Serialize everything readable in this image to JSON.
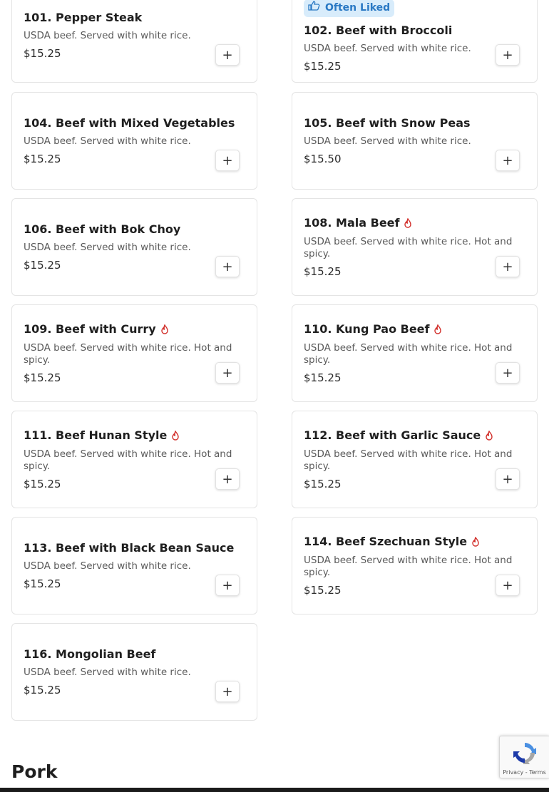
{
  "badge": {
    "label": "Often Liked",
    "icon": "thumbs-up-icon"
  },
  "items": [
    {
      "id": "101",
      "name": "101. Pepper Steak",
      "desc": "USDA beef. Served with white rice.",
      "price": "$15.25",
      "spicy": false,
      "add_label": "+"
    },
    {
      "id": "102",
      "name": "102. Beef with Broccoli",
      "desc": "USDA beef. Served with white rice.",
      "price": "$15.25",
      "spicy": false,
      "add_label": "+"
    },
    {
      "id": "104",
      "name": "104. Beef with Mixed Vegetables",
      "desc": "USDA beef. Served with white rice.",
      "price": "$15.25",
      "spicy": false,
      "add_label": "+"
    },
    {
      "id": "105",
      "name": "105. Beef with Snow Peas",
      "desc": "USDA beef. Served with white rice.",
      "price": "$15.50",
      "spicy": false,
      "add_label": "+"
    },
    {
      "id": "106",
      "name": "106. Beef with Bok Choy",
      "desc": "USDA beef. Served with white rice.",
      "price": "$15.25",
      "spicy": false,
      "add_label": "+"
    },
    {
      "id": "108",
      "name": "108. Mala Beef",
      "desc": "USDA beef. Served with white rice. Hot and spicy.",
      "price": "$15.25",
      "spicy": true,
      "add_label": "+"
    },
    {
      "id": "109",
      "name": "109. Beef with Curry",
      "desc": "USDA beef. Served with white rice. Hot and spicy.",
      "price": "$15.25",
      "spicy": true,
      "add_label": "+"
    },
    {
      "id": "110",
      "name": "110. Kung Pao Beef",
      "desc": "USDA beef. Served with white rice. Hot and spicy.",
      "price": "$15.25",
      "spicy": true,
      "add_label": "+"
    },
    {
      "id": "111",
      "name": "111. Beef Hunan Style",
      "desc": "USDA beef. Served with white rice. Hot and spicy.",
      "price": "$15.25",
      "spicy": true,
      "add_label": "+"
    },
    {
      "id": "112",
      "name": "112. Beef with Garlic Sauce",
      "desc": "USDA beef. Served with white rice. Hot and spicy.",
      "price": "$15.25",
      "spicy": true,
      "add_label": "+"
    },
    {
      "id": "113",
      "name": "113. Beef with Black Bean Sauce",
      "desc": "USDA beef. Served with white rice.",
      "price": "$15.25",
      "spicy": false,
      "add_label": "+"
    },
    {
      "id": "114",
      "name": "114. Beef Szechuan Style",
      "desc": "USDA beef. Served with white rice. Hot and spicy.",
      "price": "$15.25",
      "spicy": true,
      "add_label": "+"
    },
    {
      "id": "116",
      "name": "116. Mongolian Beef",
      "desc": "USDA beef. Served with white rice.",
      "price": "$15.25",
      "spicy": false,
      "add_label": "+"
    }
  ],
  "section": {
    "title": "Pork"
  },
  "recaptcha": {
    "links": "Privacy - Terms"
  },
  "colors": {
    "spicy": "#d2302c",
    "badge_bg": "#d8ecfb",
    "badge_text": "#2a79c4"
  }
}
